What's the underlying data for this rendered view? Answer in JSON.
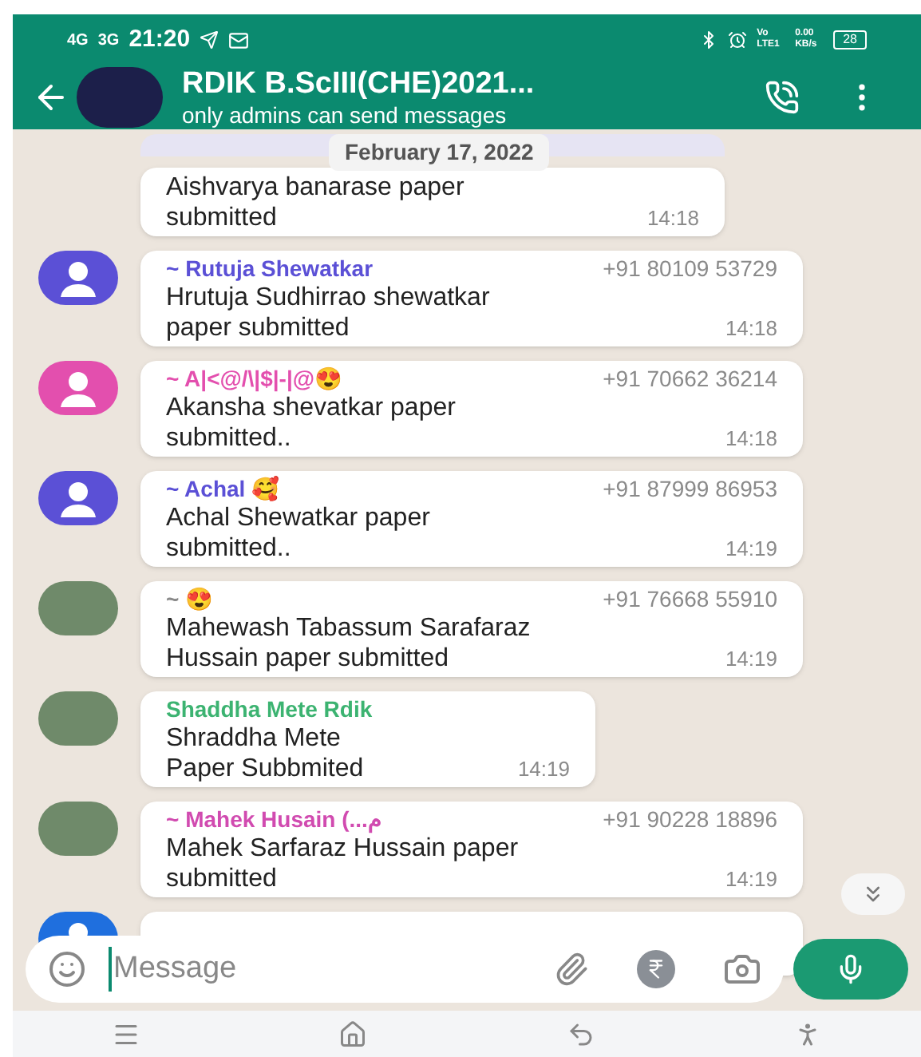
{
  "status_bar": {
    "network_1": "4G",
    "network_2": "3G",
    "time": "21:20",
    "volte": "Vo LTE1",
    "speed": "0.00 KB/s",
    "battery": "28"
  },
  "header": {
    "title": "RDIK B.ScIII(CHE)2021...",
    "subtitle": "only admins can send messages"
  },
  "date_divider": "February 17, 2022",
  "messages": [
    {
      "kind": "continuation",
      "text": "Aishvarya banarase paper\nsubmitted",
      "time": "14:18"
    },
    {
      "kind": "member",
      "avatar": {
        "kind": "person",
        "color": "#5b50d6"
      },
      "sender": {
        "name": "~ Rutuja Shewatkar",
        "color": "#5b50d6"
      },
      "phone": "+91 80109 53729",
      "text": "Hrutuja Sudhirrao shewatkar\npaper submitted",
      "time": "14:18"
    },
    {
      "kind": "member",
      "avatar": {
        "kind": "person",
        "color": "#e34fae"
      },
      "sender": {
        "name": "~ A|<@/\\|$|-|@😍",
        "color": "#e34fae"
      },
      "phone": "+91 70662 36214",
      "text": "Akansha shevatkar paper\nsubmitted..",
      "time": "14:18"
    },
    {
      "kind": "member",
      "avatar": {
        "kind": "person",
        "color": "#5b50d6"
      },
      "sender": {
        "name": "~ Achal 🥰",
        "color": "#5b50d6"
      },
      "phone": "+91 87999 86953",
      "text": "Achal Shewatkar paper\nsubmitted..",
      "time": "14:19"
    },
    {
      "kind": "member",
      "avatar": {
        "kind": "photo"
      },
      "sender": {
        "name": "~ 😍",
        "color": "#8a8a8a"
      },
      "phone": "+91 76668 55910",
      "text": "Mahewash Tabassum Sarafaraz\nHussain paper submitted",
      "time": "14:19"
    },
    {
      "kind": "contact",
      "avatar": {
        "kind": "photo"
      },
      "sender": {
        "name": "Shaddha Mete Rdik",
        "color": "#3cb371"
      },
      "text": "Shraddha Mete\nPaper Subbmited",
      "time": "14:19"
    },
    {
      "kind": "member",
      "avatar": {
        "kind": "photo"
      },
      "sender": {
        "name": "~ Mahek Husain (...م",
        "color": "#d14bb0"
      },
      "phone": "+91 90228 18896",
      "text": "Mahek Sarfaraz Hussain paper\nsubmitted",
      "time": "14:19"
    },
    {
      "kind": "member",
      "avatar": {
        "kind": "person",
        "color": "#1f6fde"
      }
    }
  ],
  "composer": {
    "placeholder": "Message"
  }
}
